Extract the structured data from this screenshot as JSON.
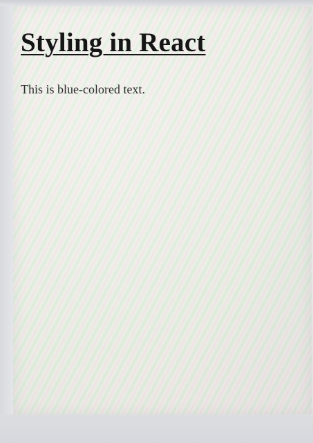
{
  "page": {
    "heading": "Styling in React",
    "paragraph": "This is blue-colored text."
  }
}
